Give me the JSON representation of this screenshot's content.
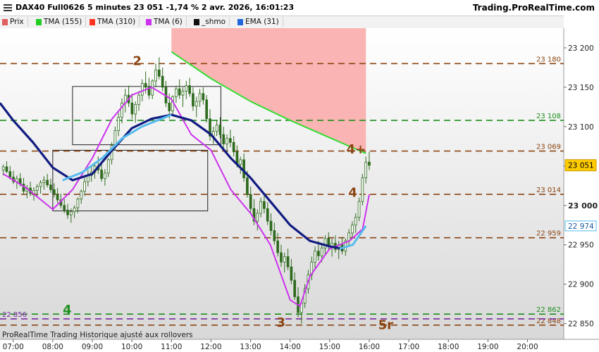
{
  "header": {
    "title": "DAX40 Full0626 5 minutes 23 051 -1,74 % 2 avr. 2026, 16:01:23",
    "site": "Trading.ProRealTime.com"
  },
  "legend": [
    {
      "label": "Prix",
      "color": "#e06060"
    },
    {
      "label": "TMA (155)",
      "color": "#22cc22"
    },
    {
      "label": "TMA (310)",
      "color": "#ff3322"
    },
    {
      "label": "TMA (6)",
      "color": "#cc33ee"
    },
    {
      "label": "_shmo",
      "color": "#111111"
    },
    {
      "label": "EMA (31)",
      "color": "#2266dd"
    }
  ],
  "footer_note": "ProRealTime Trading  Historique ajusté aux rollovers",
  "colors": {
    "candle": "#2e6b1e",
    "tma155": "#33dd33",
    "tma6": "#cc33ee",
    "ema31": "#111b80",
    "light_blue": "#55bbee",
    "red_zone": "#fbb0b0",
    "brown_level": "#8b4513",
    "green_level": "#1f8f1f",
    "purple_level": "#7a2aa0",
    "price_badge": "#ffcc00"
  },
  "chart_data": {
    "type": "candlestick",
    "x_ticks": [
      "07:00",
      "08:00",
      "09:00",
      "10:00",
      "11:00",
      "12:00",
      "13:00",
      "14:00",
      "15:00",
      "16:00",
      "17:00",
      "18:00",
      "19:00",
      "20:00"
    ],
    "x_range": [
      "06:40",
      "20:55"
    ],
    "y_ticks": [
      23200,
      23150,
      23100,
      23050,
      23000,
      22950,
      22900,
      22850
    ],
    "y_tick_labels": [
      "23 200",
      "23 150",
      "23 100",
      "23 050",
      "23 000",
      "22 950",
      "22 900",
      "22 850"
    ],
    "ylim": [
      22830,
      23225
    ],
    "grid": true,
    "last_price": {
      "label": "23 051",
      "value": 23051
    },
    "levels": [
      {
        "label": "23 180",
        "value": 23180,
        "color": "brown",
        "style": "dashed"
      },
      {
        "label": "23 108",
        "value": 23108,
        "color": "green",
        "style": "dashed"
      },
      {
        "label": "23 069",
        "value": 23069,
        "color": "brown",
        "style": "dashed"
      },
      {
        "label": "23 014",
        "value": 23014,
        "color": "brown",
        "style": "dashed"
      },
      {
        "label": "22 959",
        "value": 22959,
        "color": "brown",
        "style": "dashed"
      },
      {
        "label": "22 862",
        "value": 22862,
        "color": "green",
        "style": "dashed"
      },
      {
        "label": "22 848",
        "value": 22848,
        "color": "brown",
        "style": "dashed"
      },
      {
        "label": "22 856",
        "value": 22856,
        "color": "purple",
        "style": "dashed"
      }
    ],
    "axis_badges": [
      {
        "label": "22 974",
        "value": 22974,
        "color": "light_blue"
      }
    ],
    "wave_labels": [
      {
        "text": "2",
        "time": "10:08",
        "value": 23178,
        "color": "brown"
      },
      {
        "text": "4+",
        "time": "15:40",
        "value": 23066,
        "color": "brown"
      },
      {
        "text": "4",
        "time": "15:35",
        "value": 23011,
        "color": "brown"
      },
      {
        "text": "4",
        "time": "08:22",
        "value": 22862,
        "color": "green"
      },
      {
        "text": "3",
        "time": "13:46",
        "value": 22846,
        "color": "brown"
      },
      {
        "text": "5r",
        "time": "16:25",
        "value": 22843,
        "color": "brown"
      }
    ],
    "boxes": [
      {
        "t0": "08:30",
        "t1": "12:15",
        "p0": 23077,
        "p1": 23151
      },
      {
        "t0": "08:00",
        "t1": "11:55",
        "p0": 22993,
        "p1": 23070
      }
    ],
    "candles": [
      [
        23045,
        23052,
        23038,
        23049
      ],
      [
        23049,
        23056,
        23041,
        23043
      ],
      [
        23043,
        23050,
        23033,
        23036
      ],
      [
        23036,
        23044,
        23027,
        23030
      ],
      [
        23030,
        23038,
        23021,
        23034
      ],
      [
        23034,
        23041,
        23024,
        23027
      ],
      [
        23027,
        23035,
        23014,
        23018
      ],
      [
        23018,
        23026,
        23009,
        23022
      ],
      [
        23022,
        23030,
        23012,
        23015
      ],
      [
        23015,
        23023,
        23006,
        23019
      ],
      [
        23019,
        23027,
        23010,
        23024
      ],
      [
        23024,
        23032,
        23015,
        23029
      ],
      [
        23029,
        23037,
        23020,
        23032
      ],
      [
        23032,
        23040,
        23023,
        23026
      ],
      [
        23026,
        23034,
        23016,
        23020
      ],
      [
        23020,
        23028,
        23010,
        23014
      ],
      [
        23014,
        23022,
        23003,
        23007
      ],
      [
        23007,
        23015,
        22996,
        23000
      ],
      [
        23000,
        23008,
        22990,
        22994
      ],
      [
        22994,
        23002,
        22983,
        22988
      ],
      [
        22988,
        22996,
        22978,
        22992
      ],
      [
        22992,
        23000,
        22984,
        22997
      ],
      [
        22997,
        23010,
        22990,
        23008
      ],
      [
        23008,
        23020,
        23002,
        23018
      ],
      [
        23018,
        23035,
        23012,
        23030
      ],
      [
        23030,
        23045,
        23024,
        23038
      ],
      [
        23038,
        23050,
        23030,
        23042
      ],
      [
        23042,
        23055,
        23034,
        23050
      ],
      [
        23050,
        23062,
        23040,
        23045
      ],
      [
        23045,
        23055,
        23030,
        23034
      ],
      [
        23034,
        23046,
        23025,
        23041
      ],
      [
        23041,
        23060,
        23036,
        23058
      ],
      [
        23058,
        23080,
        23052,
        23076
      ],
      [
        23076,
        23100,
        23070,
        23095
      ],
      [
        23095,
        23118,
        23088,
        23112
      ],
      [
        23112,
        23136,
        23104,
        23130
      ],
      [
        23130,
        23148,
        23118,
        23140
      ],
      [
        23140,
        23152,
        23125,
        23130
      ],
      [
        23130,
        23142,
        23110,
        23116
      ],
      [
        23116,
        23132,
        23105,
        23128
      ],
      [
        23128,
        23145,
        23120,
        23140
      ],
      [
        23140,
        23160,
        23132,
        23155
      ],
      [
        23155,
        23170,
        23142,
        23150
      ],
      [
        23150,
        23162,
        23135,
        23140
      ],
      [
        23140,
        23160,
        23135,
        23158
      ],
      [
        23158,
        23180,
        23150,
        23172
      ],
      [
        23172,
        23188,
        23160,
        23164
      ],
      [
        23164,
        23175,
        23145,
        23150
      ],
      [
        23150,
        23158,
        23125,
        23130
      ],
      [
        23130,
        23142,
        23110,
        23120
      ],
      [
        23120,
        23140,
        23115,
        23138
      ],
      [
        23138,
        23152,
        23130,
        23148
      ],
      [
        23148,
        23160,
        23135,
        23140
      ],
      [
        23140,
        23150,
        23125,
        23145
      ],
      [
        23145,
        23158,
        23135,
        23152
      ],
      [
        23152,
        23162,
        23138,
        23142
      ],
      [
        23142,
        23150,
        23120,
        23126
      ],
      [
        23126,
        23138,
        23112,
        23132
      ],
      [
        23132,
        23148,
        23125,
        23142
      ],
      [
        23142,
        23150,
        23128,
        23134
      ],
      [
        23134,
        23140,
        23105,
        23110
      ],
      [
        23110,
        23122,
        23082,
        23088
      ],
      [
        23088,
        23100,
        23078,
        23094
      ],
      [
        23094,
        23108,
        23088,
        23102
      ],
      [
        23102,
        23112,
        23085,
        23090
      ],
      [
        23090,
        23100,
        23072,
        23078
      ],
      [
        23078,
        23090,
        23068,
        23085
      ],
      [
        23085,
        23096,
        23074,
        23080
      ],
      [
        23080,
        23088,
        23062,
        23068
      ],
      [
        23068,
        23076,
        23048,
        23052
      ],
      [
        23052,
        23062,
        23040,
        23058
      ],
      [
        23058,
        23066,
        23030,
        23035
      ],
      [
        23035,
        23044,
        23010,
        23014
      ],
      [
        23014,
        23024,
        22990,
        22996
      ],
      [
        22996,
        23008,
        22975,
        22980
      ],
      [
        22980,
        22995,
        22968,
        22990
      ],
      [
        22990,
        23010,
        22985,
        23005
      ],
      [
        23005,
        23014,
        22990,
        22996
      ],
      [
        22996,
        23004,
        22975,
        22980
      ],
      [
        22980,
        22990,
        22962,
        22968
      ],
      [
        22968,
        22978,
        22950,
        22955
      ],
      [
        22955,
        22965,
        22935,
        22940
      ],
      [
        22940,
        22950,
        22922,
        22928
      ],
      [
        22928,
        22940,
        22915,
        22935
      ],
      [
        22935,
        22945,
        22918,
        22922
      ],
      [
        22922,
        22932,
        22900,
        22905
      ],
      [
        22905,
        22915,
        22880,
        22884
      ],
      [
        22884,
        22896,
        22858,
        22864
      ],
      [
        22864,
        22880,
        22850,
        22876
      ],
      [
        22876,
        22900,
        22870,
        22894
      ],
      [
        22894,
        22918,
        22888,
        22912
      ],
      [
        22912,
        22935,
        22905,
        22928
      ],
      [
        22928,
        22948,
        22920,
        22942
      ],
      [
        22942,
        22955,
        22930,
        22936
      ],
      [
        22936,
        22950,
        22928,
        22946
      ],
      [
        22946,
        22962,
        22938,
        22958
      ],
      [
        22958,
        22966,
        22942,
        22948
      ],
      [
        22948,
        22958,
        22935,
        22952
      ],
      [
        22952,
        22962,
        22940,
        22944
      ],
      [
        22944,
        22955,
        22932,
        22950
      ],
      [
        22950,
        22960,
        22938,
        22942
      ],
      [
        22942,
        22958,
        22936,
        22955
      ],
      [
        22955,
        22970,
        22948,
        22965
      ],
      [
        22965,
        22980,
        22958,
        22975
      ],
      [
        22975,
        22990,
        22965,
        22985
      ],
      [
        22985,
        23010,
        22980,
        23005
      ],
      [
        23005,
        23040,
        23000,
        23035
      ],
      [
        23035,
        23062,
        23028,
        23055
      ],
      [
        23055,
        23068,
        23045,
        23051
      ]
    ],
    "series": [
      {
        "name": "TMA (155)",
        "color": "tma155",
        "points": [
          [
            "11:00",
            23195
          ],
          [
            "12:00",
            23161
          ],
          [
            "13:00",
            23132
          ],
          [
            "14:00",
            23108
          ],
          [
            "15:00",
            23086
          ],
          [
            "15:55",
            23066
          ]
        ]
      },
      {
        "name": "TMA (6)",
        "color": "tma6",
        "points": [
          [
            "06:45",
            23040
          ],
          [
            "07:20",
            23022
          ],
          [
            "08:00",
            22995
          ],
          [
            "08:30",
            23020
          ],
          [
            "09:00",
            23060
          ],
          [
            "09:30",
            23110
          ],
          [
            "10:00",
            23140
          ],
          [
            "10:30",
            23150
          ],
          [
            "11:00",
            23135
          ],
          [
            "11:30",
            23090
          ],
          [
            "12:00",
            23070
          ],
          [
            "12:30",
            23020
          ],
          [
            "13:00",
            22990
          ],
          [
            "13:30",
            22950
          ],
          [
            "14:00",
            22880
          ],
          [
            "14:15",
            22872
          ],
          [
            "14:30",
            22910
          ],
          [
            "15:00",
            22945
          ],
          [
            "15:30",
            22955
          ],
          [
            "15:50",
            22970
          ],
          [
            "16:00",
            23014
          ]
        ]
      },
      {
        "name": "_shmo",
        "color": "ema31",
        "points": [
          [
            "06:40",
            23130
          ],
          [
            "07:00",
            23108
          ],
          [
            "07:30",
            23080
          ],
          [
            "08:00",
            23048
          ],
          [
            "08:30",
            23032
          ],
          [
            "09:00",
            23040
          ],
          [
            "09:30",
            23070
          ],
          [
            "10:00",
            23098
          ],
          [
            "10:30",
            23110
          ],
          [
            "11:00",
            23115
          ],
          [
            "11:30",
            23108
          ],
          [
            "12:00",
            23090
          ],
          [
            "12:30",
            23060
          ],
          [
            "13:00",
            23035
          ],
          [
            "13:30",
            23005
          ],
          [
            "14:00",
            22975
          ],
          [
            "14:30",
            22955
          ],
          [
            "15:00",
            22948
          ],
          [
            "15:20",
            22945
          ]
        ]
      },
      {
        "name": "EMA (31)",
        "color": "light_blue",
        "points": [
          [
            "08:15",
            23032
          ],
          [
            "08:45",
            23042
          ],
          [
            "09:15",
            23060
          ],
          [
            "09:45",
            23085
          ],
          [
            "10:15",
            23100
          ],
          [
            "10:45",
            23110
          ],
          [
            "11:00",
            23115
          ],
          [
            "15:15",
            22945
          ],
          [
            "15:35",
            22950
          ],
          [
            "15:55",
            22974
          ]
        ]
      }
    ]
  }
}
